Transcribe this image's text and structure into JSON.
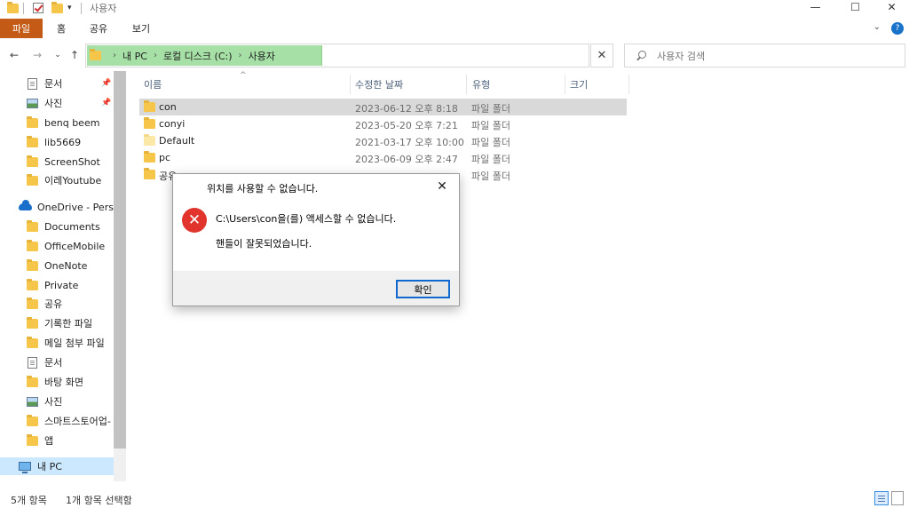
{
  "window": {
    "title": "사용자",
    "minimize_glyph": "—",
    "maximize_glyph": "☐",
    "close_glyph": "✕"
  },
  "ribbon": {
    "tabs": [
      "파일",
      "홈",
      "공유",
      "보기"
    ],
    "collapse_glyph": "⌄",
    "help_glyph": "?"
  },
  "toolbar": {
    "back_glyph": "←",
    "forward_glyph": "→",
    "recent_glyph": "⌄",
    "up_glyph": "↑"
  },
  "address": {
    "crumbs": [
      "내 PC",
      "로컬 디스크 (C:)",
      "사용자"
    ],
    "crumb_sep": "›",
    "dropdown_glyph": "⌄",
    "clear_glyph": "✕"
  },
  "search": {
    "placeholder": "사용자 검색"
  },
  "navpane": {
    "items": [
      {
        "label": "문서",
        "icon": "document-icon",
        "pinned": true
      },
      {
        "label": "사진",
        "icon": "pictures-icon",
        "pinned": true
      },
      {
        "label": "benq beem",
        "icon": "folder-icon"
      },
      {
        "label": "lib5669",
        "icon": "folder-icon"
      },
      {
        "label": "ScreenShot",
        "icon": "folder-icon"
      },
      {
        "label": "이레Youtube",
        "icon": "folder-icon"
      },
      {
        "label": "OneDrive - Person",
        "icon": "onedrive-icon"
      },
      {
        "label": "Documents",
        "icon": "folder-icon"
      },
      {
        "label": "OfficeMobile",
        "icon": "folder-icon"
      },
      {
        "label": "OneNote",
        "icon": "folder-icon"
      },
      {
        "label": "Private",
        "icon": "folder-icon"
      },
      {
        "label": "공유",
        "icon": "folder-icon"
      },
      {
        "label": "기록한 파일",
        "icon": "folder-icon"
      },
      {
        "label": "메일 첨부 파일",
        "icon": "folder-icon"
      },
      {
        "label": "문서",
        "icon": "document-icon"
      },
      {
        "label": "바탕 화면",
        "icon": "folder-icon"
      },
      {
        "label": "사진",
        "icon": "pictures-icon"
      },
      {
        "label": "스마트스토어업-",
        "icon": "folder-icon"
      },
      {
        "label": "앱",
        "icon": "folder-icon"
      },
      {
        "label": "내 PC",
        "icon": "pc-icon",
        "selected": true
      }
    ],
    "pin_glyph": "📌"
  },
  "filelist": {
    "columns": [
      "이름",
      "수정한 날짜",
      "유형",
      "크기"
    ],
    "sort_glyph": "^",
    "rows": [
      {
        "name": "con",
        "date": "2023-06-12 오후 8:18",
        "type": "파일 폴더",
        "selected": true
      },
      {
        "name": "conyi",
        "date": "2023-05-20 오후 7:21",
        "type": "파일 폴더"
      },
      {
        "name": "Default",
        "date": "2021-03-17 오후 10:00",
        "type": "파일 폴더",
        "light": true
      },
      {
        "name": "pc",
        "date": "2023-06-09 오후 2:47",
        "type": "파일 폴더"
      },
      {
        "name": "공유",
        "date": "",
        "type": "파일 폴더"
      }
    ]
  },
  "dialog": {
    "title": "위치를 사용할 수 없습니다.",
    "close_glyph": "✕",
    "error_glyph": "✕",
    "message": "C:\\Users\\con을(를) 액세스할 수 없습니다.",
    "detail": "핸들이 잘못되었습니다.",
    "ok_label": "확인"
  },
  "status": {
    "count": "5개 항목",
    "selection": "1개 항목 선택함"
  },
  "colors": {
    "file_tab": "#c35a15",
    "address_highlight": "#a6e0a6",
    "selection": "#cce8ff",
    "error": "#e0342d",
    "focus": "#0f69cf"
  }
}
